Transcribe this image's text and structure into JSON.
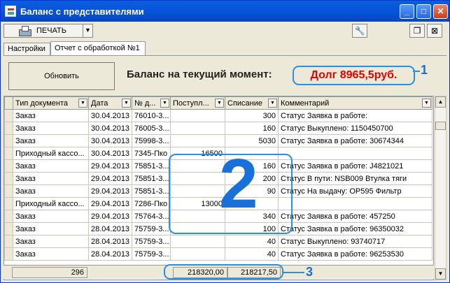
{
  "window": {
    "title": "Баланс с представителями"
  },
  "toolbar": {
    "print_label": "ПЕЧАТЬ"
  },
  "tabs": [
    {
      "label": "Настройки"
    },
    {
      "label": "Отчет с обработкой №1"
    }
  ],
  "panel": {
    "refresh_label": "Обновить",
    "balance_label": "Баланс на текущий момент:",
    "debt": "Долг 8965,5руб."
  },
  "table": {
    "columns": [
      "Тип документа",
      "Дата",
      "№ д...",
      "Поступл...",
      "Списание",
      "Комментарий"
    ],
    "rows": [
      [
        "Заказ",
        "30.04.2013",
        "76010-3...",
        "",
        "300",
        "Статус Заявка в работе:"
      ],
      [
        "Заказ",
        "30.04.2013",
        "76005-3...",
        "",
        "160",
        "Статус Выкуплено: 1150450700"
      ],
      [
        "Заказ",
        "30.04.2013",
        "75998-3...",
        "",
        "5030",
        "Статус Заявка в работе: 30674344"
      ],
      [
        "Приходный кассо...",
        "30.04.2013",
        "7345-Пко",
        "16500",
        "",
        ""
      ],
      [
        "Заказ",
        "29.04.2013",
        "75851-3...",
        "",
        "160",
        "Статус Заявка в работе: J4821021"
      ],
      [
        "Заказ",
        "29.04.2013",
        "75851-3...",
        "",
        "200",
        "Статус В пути: NSB009 Втулка тяги"
      ],
      [
        "Заказ",
        "29.04.2013",
        "75851-3...",
        "",
        "90",
        "Статус На выдачу: OP595 Фильтр"
      ],
      [
        "Приходный кассо...",
        "29.04.2013",
        "7286-Пко",
        "13000",
        "",
        ""
      ],
      [
        "Заказ",
        "29.04.2013",
        "75764-3...",
        "",
        "340",
        "Статус Заявка в работе: 457250"
      ],
      [
        "Заказ",
        "28.04.2013",
        "75759-3...",
        "",
        "100",
        "Статус Заявка в работе: 96350032"
      ],
      [
        "Заказ",
        "28.04.2013",
        "75759-3...",
        "",
        "40",
        "Статус Выкуплено: 93740717"
      ],
      [
        "Заказ",
        "28.04.2013",
        "75759-3...",
        "",
        "40",
        "Статус Заявка в работе: 96253530"
      ]
    ]
  },
  "footer": {
    "count": "296",
    "income_total": "218320,00",
    "expense_total": "218217,50"
  },
  "annotations": {
    "label1": "1",
    "label2": "2",
    "label3": "3"
  }
}
